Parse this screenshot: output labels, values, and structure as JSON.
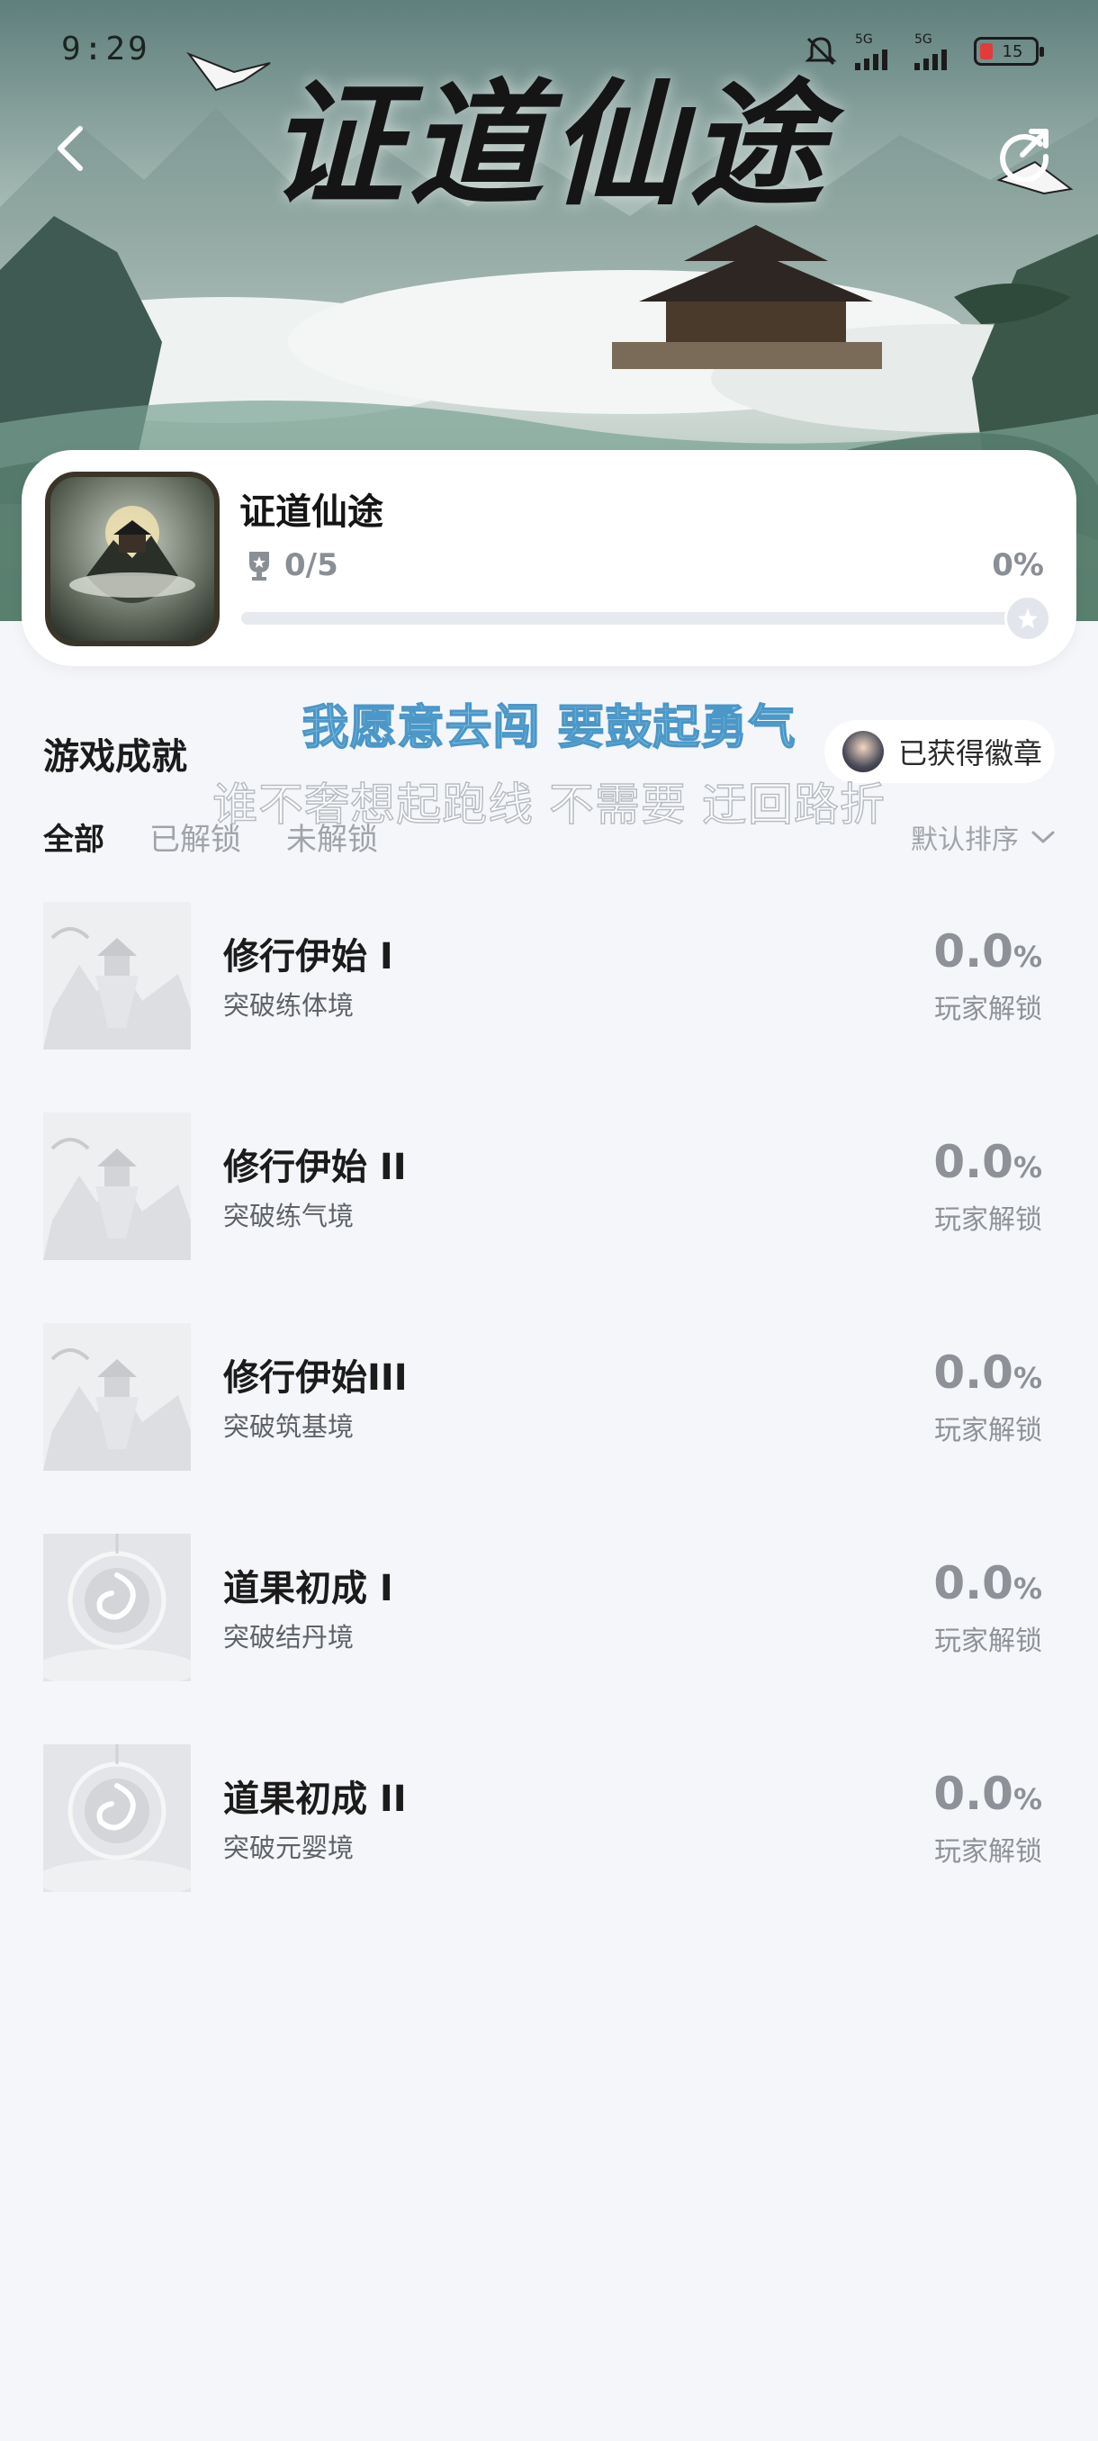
{
  "status_bar": {
    "time": "9:29",
    "network_1": "5G",
    "network_2": "5G",
    "battery": "15"
  },
  "hero": {
    "banner_title": "证道仙途"
  },
  "game": {
    "name": "证道仙途",
    "trophy_progress": "0/5",
    "progress_percent": "0%",
    "progress_fraction": 0.0
  },
  "section": {
    "title": "游戏成就",
    "badge_label": "已获得徽章"
  },
  "tabs": [
    {
      "label": "全部",
      "active": true
    },
    {
      "label": "已解锁",
      "active": false
    },
    {
      "label": "未解锁",
      "active": false
    }
  ],
  "sort": {
    "label": "默认排序"
  },
  "lyrics": {
    "line1": "我愿意去闯 要鼓起勇气",
    "line2": "谁不奢想起跑线 不需要 迂回路折"
  },
  "achievements": [
    {
      "title": "修行伊始 I",
      "desc": "突破练体境",
      "rate": "0.0",
      "unit": "%",
      "rate_label": "玩家解锁",
      "thumb": "pavilion"
    },
    {
      "title": "修行伊始 II",
      "desc": "突破练气境",
      "rate": "0.0",
      "unit": "%",
      "rate_label": "玩家解锁",
      "thumb": "pavilion"
    },
    {
      "title": "修行伊始III",
      "desc": "突破筑基境",
      "rate": "0.0",
      "unit": "%",
      "rate_label": "玩家解锁",
      "thumb": "pavilion"
    },
    {
      "title": "道果初成 I",
      "desc": "突破结丹境",
      "rate": "0.0",
      "unit": "%",
      "rate_label": "玩家解锁",
      "thumb": "orb"
    },
    {
      "title": "道果初成 II",
      "desc": "突破元婴境",
      "rate": "0.0",
      "unit": "%",
      "rate_label": "玩家解锁",
      "thumb": "orb"
    }
  ]
}
